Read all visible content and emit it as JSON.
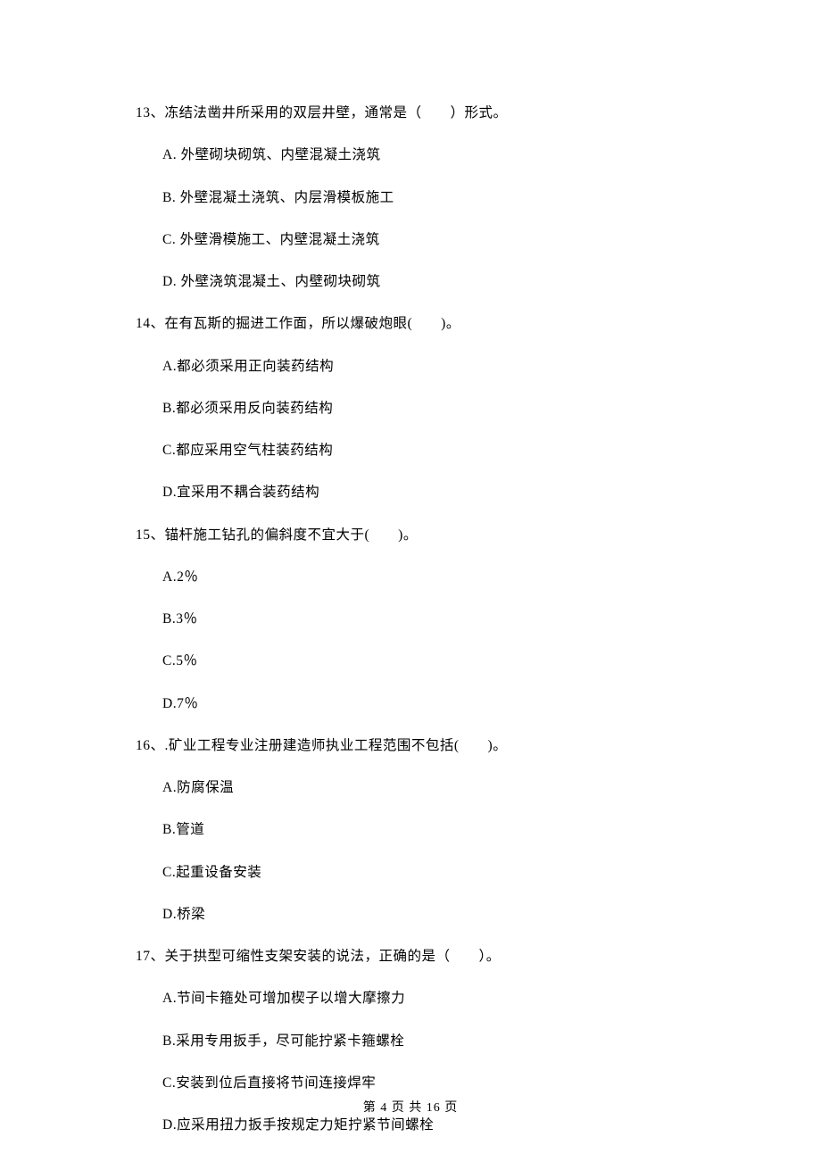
{
  "questions": [
    {
      "number": "13、",
      "stem": "冻结法凿井所采用的双层井壁，通常是（　　）形式。",
      "options": [
        "A.  外壁砌块砌筑、内壁混凝土浇筑",
        "B.  外壁混凝土浇筑、内层滑模板施工",
        "C.  外壁滑模施工、内壁混凝土浇筑",
        "D.  外壁浇筑混凝土、内壁砌块砌筑"
      ]
    },
    {
      "number": "14、",
      "stem": "在有瓦斯的掘进工作面，所以爆破炮眼(　　)。",
      "options": [
        "A.都必须采用正向装药结构",
        "B.都必须采用反向装药结构",
        "C.都应采用空气柱装药结构",
        "D.宜采用不耦合装药结构"
      ]
    },
    {
      "number": "15、",
      "stem": "锚杆施工钻孔的偏斜度不宜大于(　　)。",
      "options": [
        "A.2％",
        "B.3％",
        "C.5％",
        "D.7％"
      ]
    },
    {
      "number": "16、",
      "stem": ".矿业工程专业注册建造师执业工程范围不包括(　　)。",
      "options": [
        "A.防腐保温",
        "B.管道",
        "C.起重设备安装",
        "D.桥梁"
      ]
    },
    {
      "number": "17、",
      "stem": "关于拱型可缩性支架安装的说法，正确的是（　　）。",
      "options": [
        "A.节间卡箍处可增加楔子以增大摩擦力",
        "B.采用专用扳手，尽可能拧紧卡箍螺栓",
        "C.安装到位后直接将节间连接焊牢",
        "D.应采用扭力扳手按规定力矩拧紧节间螺栓"
      ]
    }
  ],
  "footer": "第 4 页 共 16 页"
}
